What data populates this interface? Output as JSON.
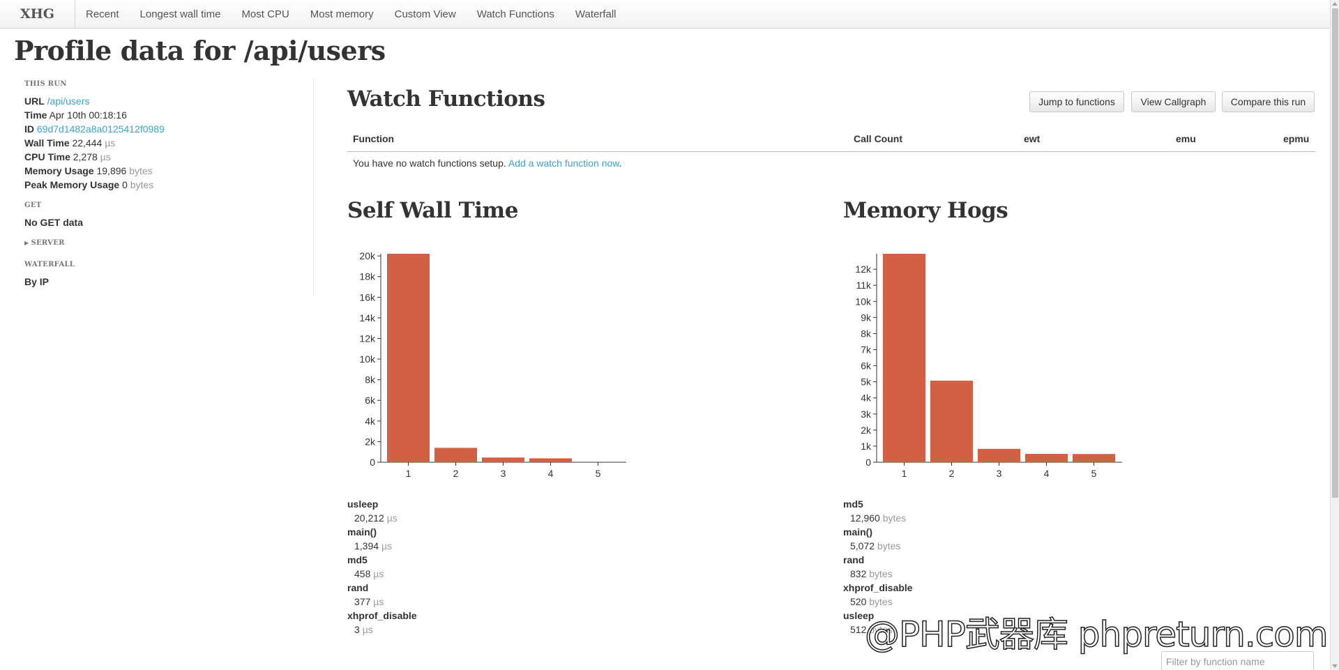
{
  "nav": {
    "brand": "XHG",
    "items": [
      "Recent",
      "Longest wall time",
      "Most CPU",
      "Most memory",
      "Custom View",
      "Watch Functions",
      "Waterfall"
    ]
  },
  "page_title": "Profile data for /api/users",
  "sidebar": {
    "this_run_heading": "THIS RUN",
    "url_label": "URL",
    "url_value": "/api/users",
    "time_label": "Time",
    "time_value": "Apr 10th 00:18:16",
    "id_label": "ID",
    "id_value": "69d7d1482a8a0125412f0989",
    "wall_label": "Wall Time",
    "wall_value": "22,444",
    "wall_unit": "µs",
    "cpu_label": "CPU Time",
    "cpu_value": "2,278",
    "cpu_unit": "µs",
    "mem_label": "Memory Usage",
    "mem_value": "19,896",
    "mem_unit": "bytes",
    "peak_label": "Peak Memory Usage",
    "peak_value": "0",
    "peak_unit": "bytes",
    "get_heading": "GET",
    "get_value": "No GET data",
    "server_heading": "SERVER",
    "waterfall_heading": "WATERFALL",
    "waterfall_link": "By IP"
  },
  "watch": {
    "title": "Watch Functions",
    "buttons": [
      "Jump to functions",
      "View Callgraph",
      "Compare this run"
    ],
    "columns": [
      "Function",
      "Call Count",
      "ewt",
      "emu",
      "epmu"
    ],
    "empty_text": "You have no watch functions setup.",
    "empty_link": "Add a watch function now",
    "empty_suffix": "."
  },
  "self_wall": {
    "title": "Self Wall Time",
    "unit": "µs",
    "items": [
      {
        "name": "usleep",
        "value": "20,212"
      },
      {
        "name": "main()",
        "value": "1,394"
      },
      {
        "name": "md5",
        "value": "458"
      },
      {
        "name": "rand",
        "value": "377"
      },
      {
        "name": "xhprof_disable",
        "value": "3"
      }
    ]
  },
  "memory_hogs": {
    "title": "Memory Hogs",
    "unit": "bytes",
    "items": [
      {
        "name": "md5",
        "value": "12,960"
      },
      {
        "name": "main()",
        "value": "5,072"
      },
      {
        "name": "rand",
        "value": "832"
      },
      {
        "name": "xhprof_disable",
        "value": "520"
      },
      {
        "name": "usleep",
        "value": "512"
      }
    ]
  },
  "filter": {
    "placeholder": "Filter by function name"
  },
  "watermark": "@PHP武器库 phpreturn.com",
  "colors": {
    "bar": "#d26144",
    "link": "#3aa3c9"
  },
  "chart_data": [
    {
      "type": "bar",
      "title": "Self Wall Time",
      "categories": [
        "1",
        "2",
        "3",
        "4",
        "5"
      ],
      "values": [
        20212,
        1394,
        458,
        377,
        3
      ],
      "yticks": [
        "0",
        "2k",
        "4k",
        "6k",
        "8k",
        "10k",
        "12k",
        "14k",
        "16k",
        "18k",
        "20k"
      ],
      "ylim": [
        0,
        20212
      ]
    },
    {
      "type": "bar",
      "title": "Memory Hogs",
      "categories": [
        "1",
        "2",
        "3",
        "4",
        "5"
      ],
      "values": [
        12960,
        5072,
        832,
        520,
        512
      ],
      "yticks": [
        "0",
        "1k",
        "2k",
        "3k",
        "4k",
        "5k",
        "6k",
        "7k",
        "8k",
        "9k",
        "10k",
        "11k",
        "12k"
      ],
      "ylim": [
        0,
        12960
      ]
    }
  ]
}
